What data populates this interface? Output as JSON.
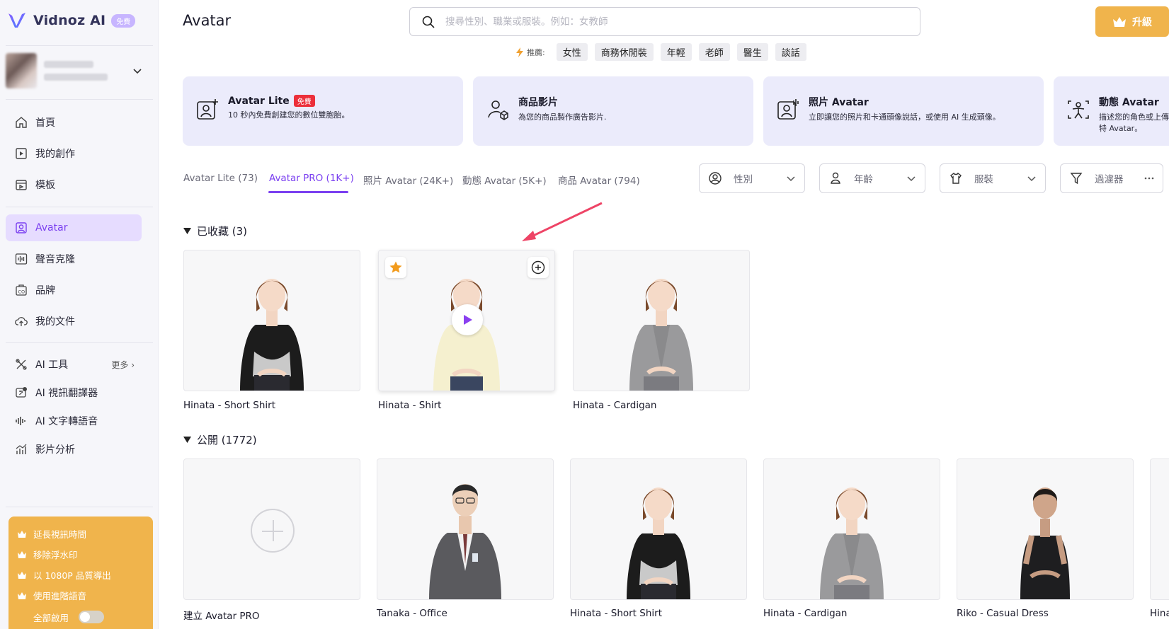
{
  "brand": {
    "name": "Vidnoz AI",
    "badge": "免費",
    "accent": "#7a3ff0",
    "gold": "#f0b44c"
  },
  "sidebar": {
    "nav": [
      {
        "label": "首頁",
        "icon": "home-icon"
      },
      {
        "label": "我的創作",
        "icon": "video-icon"
      },
      {
        "label": "模板",
        "icon": "template-icon"
      },
      {
        "label": "Avatar",
        "icon": "avatar-icon",
        "active": true
      },
      {
        "label": "聲音克隆",
        "icon": "waveform-icon"
      },
      {
        "label": "品牌",
        "icon": "brand-icon"
      },
      {
        "label": "我的文件",
        "icon": "upload-cloud-icon"
      }
    ],
    "tools": [
      {
        "label": "AI 工具",
        "icon": "tools-icon",
        "more": "更多"
      },
      {
        "label": "AI 視訊翻譯器",
        "icon": "translate-icon"
      },
      {
        "label": "AI 文字轉語音",
        "icon": "tts-icon"
      },
      {
        "label": "影片分析",
        "icon": "analytics-icon"
      }
    ],
    "promo": {
      "items": [
        "延長視訊時間",
        "移除浮水印",
        "以 1080P 品質導出",
        "使用進階語音"
      ],
      "toggle_label": "全部啟用"
    }
  },
  "header": {
    "title": "Avatar",
    "search_placeholder": "搜尋性別、職業或服裝。例如：女教師",
    "upgrade_label": "升級",
    "tags_label": "推薦:",
    "tags": [
      "女性",
      "商務休閒裝",
      "年輕",
      "老師",
      "醫生",
      "談話"
    ]
  },
  "categories": [
    {
      "title": "Avatar Lite",
      "badge": "免費",
      "desc": "10 秒內免費創建您的數位雙胞胎。"
    },
    {
      "title": "商品影片",
      "desc": "為您的商品製作廣告影片."
    },
    {
      "title": "照片 Avatar",
      "desc": "立即讓您的照片和卡通頭像說話，或使用 AI 生成頭像。"
    },
    {
      "title": "動態 Avatar",
      "desc": "描述您的角色或上傳",
      "desc2": "特 Avatar。"
    }
  ],
  "tabs": [
    "Avatar Lite (73)",
    "Avatar PRO (1K+)",
    "照片 Avatar (24K+)",
    "動態 Avatar (5K+)",
    "商品 Avatar (794)"
  ],
  "filters": [
    "性別",
    "年齡",
    "服裝",
    "過濾器"
  ],
  "favorites": {
    "title": "已收藏 (3)",
    "items": [
      "Hinata - Short Shirt",
      "Hinata - Shirt",
      "Hinata - Cardigan"
    ]
  },
  "public": {
    "title": "公開 (1772)",
    "items": [
      "建立 Avatar PRO",
      "Tanaka - Office",
      "Hinata - Short Shirt",
      "Hinata - Cardigan",
      "Riko - Casual Dress",
      "Hina"
    ]
  }
}
